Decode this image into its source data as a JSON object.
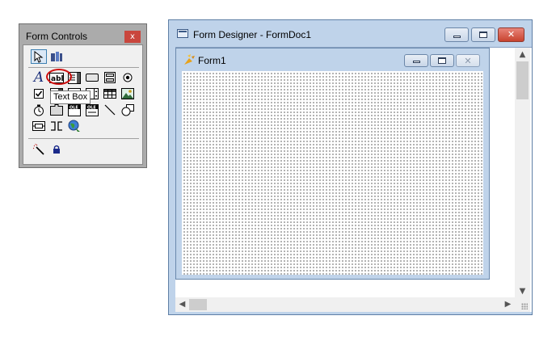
{
  "toolbox": {
    "title": "Form Controls",
    "close_label": "x",
    "tooltip": "Text Box",
    "pointer_selected": true,
    "rows": [
      [
        "pointer-tool-icon",
        "builder-lock-tool-icon"
      ],
      [
        "label-tool-icon",
        "text-box-tool-icon",
        "edit-box-tool-icon",
        "command-button-tool-icon",
        "command-group-tool-icon",
        "option-group-tool-icon"
      ],
      [
        "check-box-tool-icon",
        "combo-box-tool-icon",
        "list-box-tool-icon",
        "spinner-tool-icon",
        "grid-tool-icon",
        "image-tool-icon"
      ],
      [
        "timer-tool-icon",
        "page-frame-tool-icon",
        "activex-control-tool-icon",
        "activex-bound-control-tool-icon",
        "line-tool-icon",
        "shape-tool-icon"
      ],
      [
        "container-tool-icon",
        "separator-tool-icon",
        "hyperlink-tool-icon"
      ],
      [
        "builder-wand-icon",
        "lock-icon"
      ]
    ]
  },
  "designer": {
    "title": "Form Designer - FormDoc1",
    "form_title": "Form1",
    "colors": {
      "title_bg": "#bfd3ea",
      "close_button": "#c8432f"
    }
  }
}
